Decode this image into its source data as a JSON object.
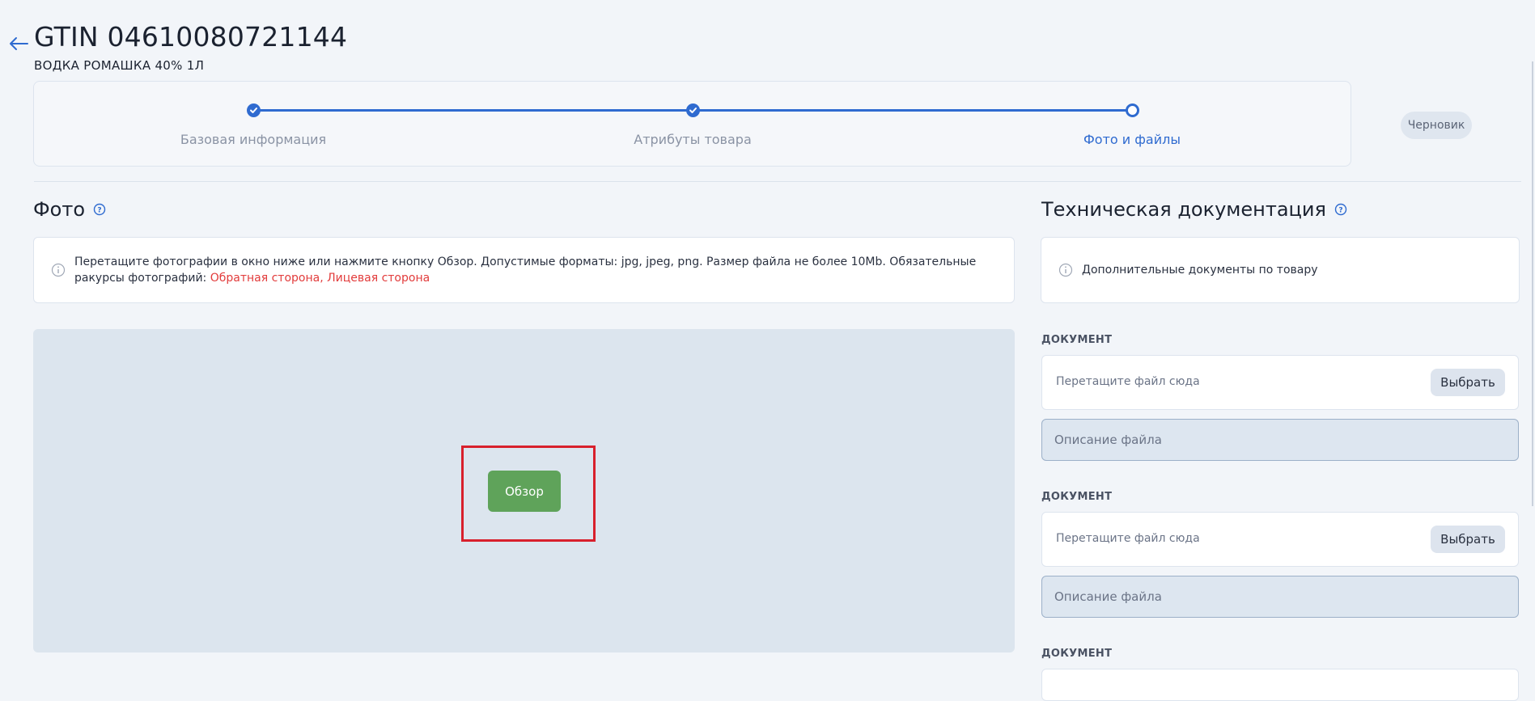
{
  "header": {
    "title": "GTIN 04610080721144",
    "subtitle": "ВОДКА РОМАШКА 40% 1Л"
  },
  "stepper": {
    "steps": [
      {
        "label": "Базовая информация",
        "state": "done"
      },
      {
        "label": "Атрибуты товара",
        "state": "done"
      },
      {
        "label": "Фото и файлы",
        "state": "current"
      }
    ]
  },
  "status": "Черновик",
  "photo": {
    "title": "Фото",
    "info_text": "Перетащите фотографии в окно ниже или нажмите кнопку Обзор. Допустимые форматы: jpg, jpeg, png. Размер файла не более 10Mb. Обязательные ракурсы фотографий: ",
    "required_views": "Обратная сторона, Лицевая сторона",
    "browse_label": "Обзор"
  },
  "tech_docs": {
    "title": "Техническая документация",
    "info_text": "Дополнительные документы по товару",
    "documents": [
      {
        "label": "ДОКУМЕНТ",
        "drop_hint": "Перетащите файл сюда",
        "choose_label": "Выбрать",
        "description_placeholder": "Описание файла"
      },
      {
        "label": "ДОКУМЕНТ",
        "drop_hint": "Перетащите файл сюда",
        "choose_label": "Выбрать",
        "description_placeholder": "Описание файла"
      },
      {
        "label": "ДОКУМЕНТ"
      }
    ]
  },
  "colors": {
    "accent": "#2f6bd0",
    "browse_button": "#5fa35a",
    "required_text": "#e23b3b",
    "highlight_box": "#d8202c",
    "dropzone": "#dce5ee"
  },
  "icons": {
    "back": "arrow-left-icon",
    "help": "question-circle-icon",
    "info": "info-circle-icon",
    "step_done": "check-icon"
  }
}
